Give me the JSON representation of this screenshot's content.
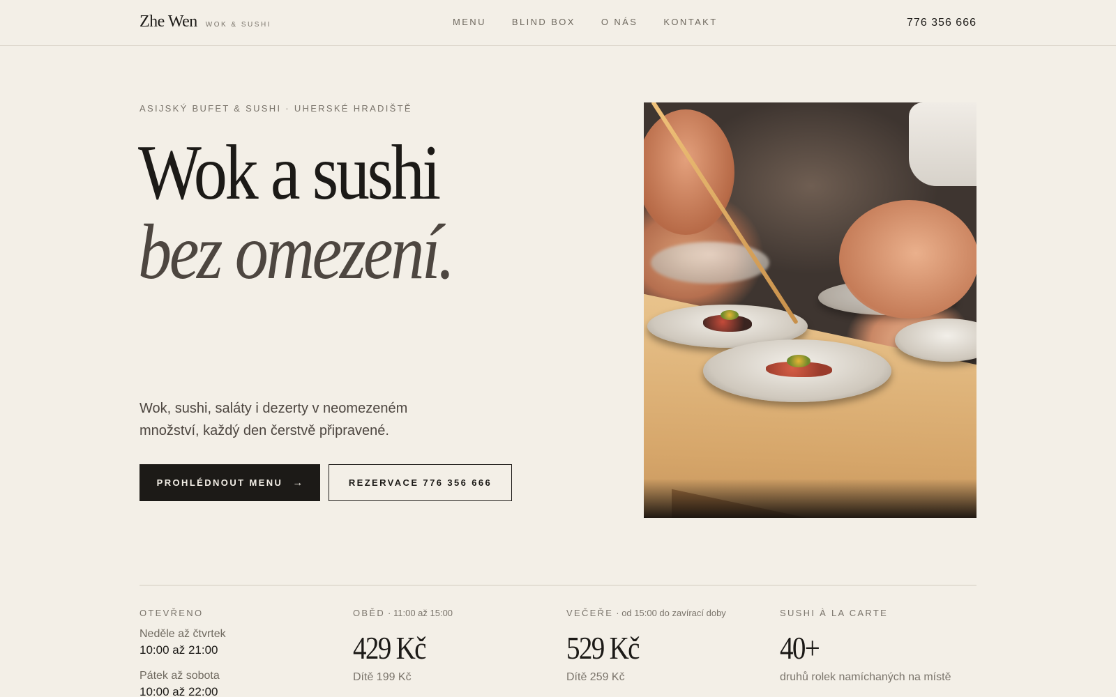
{
  "header": {
    "brand_name": "Zhe Wen",
    "brand_tag": "WOK & SUSHI",
    "nav": [
      "MENU",
      "BLIND BOX",
      "O NÁS",
      "KONTAKT"
    ],
    "phone": "776 356 666"
  },
  "hero": {
    "eyebrow": "ASIJSKÝ BUFET & SUSHI · UHERSKÉ HRADIŠTĚ",
    "title_line1": "Wok a sushi",
    "title_line2": "bez omezení.",
    "lede": "Wok, sushi, saláty i dezerty v neomezeném množství, každý den čerstvě připravené.",
    "primary_cta": "PROHLÉDNOUT MENU",
    "primary_cta_icon": "→",
    "secondary_cta": "REZERVACE 776 356 666",
    "photo_icon": "chef-plating-sushi-photo"
  },
  "info": {
    "open": {
      "label": "OTEVŘENO",
      "rows": [
        {
          "days": "Neděle až čtvrtek",
          "time": "10:00 až 21:00"
        },
        {
          "days": "Pátek až sobota",
          "time": "10:00 až 22:00"
        }
      ]
    },
    "lunch": {
      "label": "OBĚD",
      "sub": "· 11:00 až 15:00",
      "price": "429 Kč",
      "note": "Dítě 199 Kč"
    },
    "dinner": {
      "label": "VEČEŘE",
      "sub": "· od 15:00 do zavírací doby",
      "price": "529 Kč",
      "note": "Dítě 259 Kč"
    },
    "sushi": {
      "label": "SUSHI À LA CARTE",
      "count": "40+",
      "note": "druhů rolek namíchaných na místě"
    }
  },
  "colors": {
    "background": "#f3efe7",
    "ink": "#1c1a17",
    "muted": "#7a746b",
    "button_dark": "#1c1a17"
  }
}
